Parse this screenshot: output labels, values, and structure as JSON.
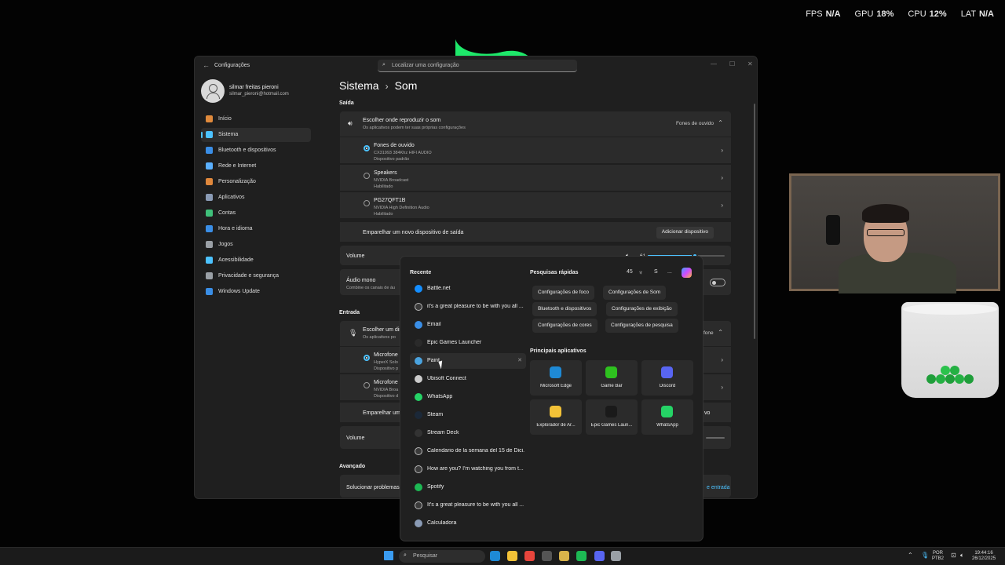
{
  "overlay": {
    "stats": [
      {
        "label": "FPS",
        "value": "N/A"
      },
      {
        "label": "GPU",
        "value": "18%"
      },
      {
        "label": "CPU",
        "value": "12%"
      },
      {
        "label": "LAT",
        "value": "N/A"
      }
    ]
  },
  "settings": {
    "title": "Configurações",
    "search_placeholder": "Localizar uma configuração",
    "profile": {
      "name": "silmar freitas pieroni",
      "email": "silmar_pieroni@hotmail.com"
    },
    "nav": [
      {
        "label": "Início",
        "icon": "home-icon",
        "color": "#e08a3c"
      },
      {
        "label": "Sistema",
        "icon": "system-icon",
        "color": "#4cc2ff",
        "active": true
      },
      {
        "label": "Bluetooth e dispositivos",
        "icon": "bluetooth-icon",
        "color": "#3a8ee6"
      },
      {
        "label": "Rede e Internet",
        "icon": "wifi-icon",
        "color": "#5ab0ff"
      },
      {
        "label": "Personalização",
        "icon": "brush-icon",
        "color": "#e0883c"
      },
      {
        "label": "Aplicativos",
        "icon": "apps-icon",
        "color": "#8a9bb5"
      },
      {
        "label": "Contas",
        "icon": "account-icon",
        "color": "#3fc07a"
      },
      {
        "label": "Hora e idioma",
        "icon": "globe-icon",
        "color": "#3a8ee6"
      },
      {
        "label": "Jogos",
        "icon": "gamepad-icon",
        "color": "#9aa0a6"
      },
      {
        "label": "Acessibilidade",
        "icon": "accessibility-icon",
        "color": "#4cc2ff"
      },
      {
        "label": "Privacidade e segurança",
        "icon": "shield-icon",
        "color": "#9aa0a6"
      },
      {
        "label": "Windows Update",
        "icon": "update-icon",
        "color": "#3a8ee6"
      }
    ],
    "breadcrumb": {
      "parent": "Sistema",
      "current": "Som"
    },
    "output": {
      "section_label": "Saída",
      "choose_title": "Escolher onde reproduzir o som",
      "choose_sub": "Os aplicativos podem ter suas próprias configurações",
      "selected": "Fones de ouvido",
      "devices": [
        {
          "name": "Fones de ouvido",
          "sub1": "CX31993 384Khz HIFI AUDIO",
          "sub2": "Dispositivo padrão",
          "selected": true
        },
        {
          "name": "Speakers",
          "sub1": "NVIDIA Broadcast",
          "sub2": "Habilitado",
          "selected": false
        },
        {
          "name": "PG27QFT1B",
          "sub1": "NVIDIA High Definition Audio",
          "sub2": "Habilitado",
          "selected": false
        }
      ],
      "pair_label": "Emparelhar um novo dispositivo de saída",
      "add_button": "Adicionar dispositivo",
      "volume_label": "Volume",
      "volume_value": "61",
      "volume_fraction": 0.61,
      "mono_title": "Áudio mono",
      "mono_sub": "Combine os canais de áu"
    },
    "input": {
      "section_label": "Entrada",
      "choose_title": "Escolher um dis",
      "choose_sub": "Os aplicativos po",
      "selected_partial": "fone",
      "devices": [
        {
          "name": "Microfone",
          "sub1": "HyperX Solo",
          "sub2": "Dispositivo p",
          "selected": true
        },
        {
          "name": "Microfone",
          "sub1": "NVIDIA Broa",
          "sub2": "Dispositivo d",
          "selected": false
        }
      ],
      "pair_label": "Emparelhar um",
      "pair_button_partial": "vo",
      "volume_label": "Volume"
    },
    "advanced": {
      "section_label": "Avançado",
      "troubleshoot_label": "Solucionar problemas",
      "troubleshoot_right": "e entrada"
    }
  },
  "start_menu": {
    "recent_header": "Recente",
    "recent": [
      {
        "label": "Battle.net",
        "icon": "battlenet-icon",
        "color": "#148eff"
      },
      {
        "label": "it's a great pleasure to be with you all ...",
        "icon": "search-icon",
        "color": "#dddddd"
      },
      {
        "label": "Email",
        "icon": "mail-icon",
        "color": "#3a8ee6"
      },
      {
        "label": "Epic Games Launcher",
        "icon": "epic-icon",
        "color": "#2a2a2a"
      },
      {
        "label": "Paint",
        "icon": "paint-icon",
        "color": "#4aa3df",
        "hover": true
      },
      {
        "label": "Ubisoft Connect",
        "icon": "ubisoft-icon",
        "color": "#cccccc"
      },
      {
        "label": "WhatsApp",
        "icon": "whatsapp-icon",
        "color": "#25d366"
      },
      {
        "label": "Steam",
        "icon": "steam-icon",
        "color": "#1b2838"
      },
      {
        "label": "Stream Deck",
        "icon": "streamdeck-icon",
        "color": "#333333"
      },
      {
        "label": "Calendario de la semana del 15 de Dici...",
        "icon": "search-icon",
        "color": "#dddddd"
      },
      {
        "label": "How are you? I'm watching you from t...",
        "icon": "search-icon",
        "color": "#dddddd"
      },
      {
        "label": "Spotify",
        "icon": "spotify-icon",
        "color": "#1db954"
      },
      {
        "label": "It's a great pleasure to be with you all ...",
        "icon": "search-icon",
        "color": "#dddddd"
      },
      {
        "label": "Calculadora",
        "icon": "calculator-icon",
        "color": "#8a9bb5"
      }
    ],
    "quick_header": "Pesquisas rápidas",
    "quick_count": "45",
    "quick_letter": "S",
    "quick_more": "...",
    "chips": [
      "Configurações de foco",
      "Configurações de Som",
      "Bluetooth e dispositivos",
      "Configurações de exibição",
      "Configurações de cores",
      "Configurações de pesquisa"
    ],
    "apps_header": "Principais aplicativos",
    "apps": [
      {
        "label": "Microsoft Edge",
        "icon": "edge-icon",
        "color": "#1e8ad6"
      },
      {
        "label": "Game Bar",
        "icon": "gamebar-icon",
        "color": "#2ec21f"
      },
      {
        "label": "Discord",
        "icon": "discord-icon",
        "color": "#5865f2"
      },
      {
        "label": "Explorador de Ar...",
        "icon": "folder-icon",
        "color": "#f3c237"
      },
      {
        "label": "Epic Games Laun...",
        "icon": "epic-icon",
        "color": "#1a1a1a"
      },
      {
        "label": "WhatsApp",
        "icon": "whatsapp-icon",
        "color": "#25d366"
      }
    ]
  },
  "taskbar": {
    "search_placeholder": "Pesquisar",
    "icons": [
      {
        "name": "windows-start-icon",
        "color": "#3a9bf0"
      },
      {
        "name": "edge-icon",
        "color": "#1e8ad6"
      },
      {
        "name": "file-explorer-icon",
        "color": "#f3c237"
      },
      {
        "name": "chrome-icon",
        "color": "#e8453c"
      },
      {
        "name": "app-icon",
        "color": "#555555"
      },
      {
        "name": "pen-icon",
        "color": "#d8b34a"
      },
      {
        "name": "spotify-icon",
        "color": "#1db954"
      },
      {
        "name": "discord-icon",
        "color": "#5865f2"
      },
      {
        "name": "settings-icon",
        "color": "#9aa0a6"
      }
    ],
    "lang_top": "POR",
    "lang_bottom": "PTB2",
    "time": "19:44:16",
    "date": "26/12/2025"
  }
}
